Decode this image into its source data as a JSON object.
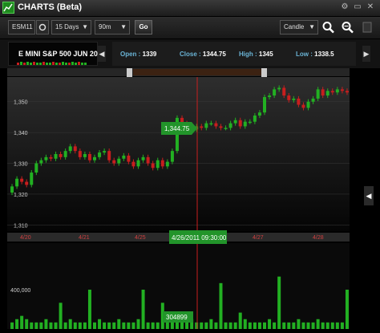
{
  "window": {
    "title": "CHARTS (Beta)",
    "icon": "chart-app-icon"
  },
  "toolbar": {
    "symbol": "ESM11",
    "range": "15 Days",
    "interval": "90m",
    "go_label": "Go",
    "chart_type": "Candle"
  },
  "instrument": {
    "name": "E MINI S&P 500 JUN 20"
  },
  "quote": {
    "open_label": "Open :",
    "open_value": "1339",
    "close_label": "Close :",
    "close_value": "1344.75",
    "high_label": "High :",
    "high_value": "1345",
    "low_label": "Low :",
    "low_value": "1338.5"
  },
  "cursor": {
    "price_label": "1,344.75",
    "time_label": "4/26/2011 09:30:00",
    "volume_label": "304899"
  },
  "colors": {
    "up": "#22b022",
    "down": "#c81e1e",
    "cursor": "#c81e1e",
    "label_bg": "#22942a"
  },
  "chart_data": {
    "type": "candlestick",
    "y_ticks": [
      "1,350",
      "1,340",
      "1,330",
      "1,320",
      "1,310"
    ],
    "y_tick_values": [
      1350,
      1340,
      1330,
      1320,
      1310
    ],
    "ylim": [
      1308,
      1358
    ],
    "x_ticks": [
      "4/20",
      "4/21",
      "4/25",
      "4/26",
      "4/27",
      "4/28"
    ],
    "volume_tick": "400,000",
    "closes": [
      1322.5,
      1325,
      1324,
      1323,
      1327,
      1330,
      1331,
      1332,
      1331.5,
      1333,
      1332,
      1334,
      1335.5,
      1334,
      1332,
      1333,
      1331,
      1332,
      1333.5,
      1334,
      1331,
      1330,
      1331.5,
      1332.5,
      1330.5,
      1329,
      1331,
      1332,
      1330,
      1328.5,
      1331,
      1329,
      1330.5,
      1334,
      1344.75,
      1343,
      1341.5,
      1341,
      1342,
      1341.5,
      1343,
      1343,
      1342,
      1341.5,
      1341.5,
      1343,
      1344,
      1342,
      1343.5,
      1343.5,
      1345.5,
      1346.5,
      1351.5,
      1352,
      1354,
      1354.5,
      1352,
      1350.5,
      1351,
      1349,
      1348,
      1350,
      1351,
      1354,
      1352,
      1353.5,
      1353,
      1354,
      1353.5,
      1353
    ],
    "volume": [
      0.02,
      0.03,
      0.04,
      0.03,
      0.02,
      0.02,
      0.02,
      0.03,
      0.02,
      0.02,
      0.08,
      0.02,
      0.03,
      0.02,
      0.02,
      0.02,
      0.12,
      0.02,
      0.03,
      0.02,
      0.02,
      0.02,
      0.03,
      0.02,
      0.02,
      0.02,
      0.03,
      0.12,
      0.02,
      0.02,
      0.02,
      0.08,
      0.02,
      0.02,
      0.04,
      0.02,
      0.02,
      0.03,
      0.02,
      0.02,
      0.02,
      0.03,
      0.02,
      0.14,
      0.02,
      0.02,
      0.02,
      0.05,
      0.03,
      0.02,
      0.02,
      0.02,
      0.02,
      0.03,
      0.02,
      0.16,
      0.02,
      0.02,
      0.02,
      0.03,
      0.02,
      0.02,
      0.02,
      0.03,
      0.02,
      0.02,
      0.02,
      0.02,
      0.02,
      0.12
    ]
  }
}
